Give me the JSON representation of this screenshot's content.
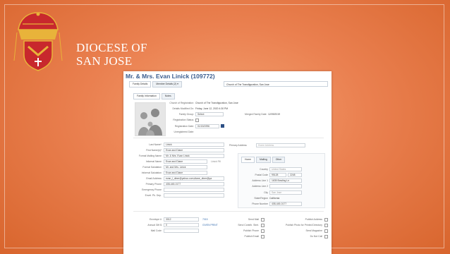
{
  "org": {
    "line1": "DIOCESE OF",
    "line2": "SAN JOSE"
  },
  "window": {
    "title": "Mr. & Mrs. Evan Linick (109772)"
  },
  "top_tabs": [
    "Family Details",
    "Member Details (2) ▾"
  ],
  "parish_select": "Church of The Transfiguration, San Jose",
  "sub_tabs": [
    "Family Information",
    "Notes"
  ],
  "registration": {
    "church_label": "Church of Registration:",
    "church_value": "Church of The Transfiguration, San Jose",
    "modified_label": "Details Modified On:",
    "modified_value": "Friday, June 12, 2020 4:30 PM",
    "group_label": "Family Group:",
    "group_value": "Select",
    "merged_label": "Merged Family Date:",
    "merged_value": "12/09/2019",
    "status_label": "Registration Status:",
    "regdate_label": "Registration Date:",
    "regdate_value": "01/15/1996",
    "unregistered_label": "Unregistered Date:"
  },
  "fields": [
    {
      "label": "Last Name*",
      "value": "Linick"
    },
    {
      "label": "First Name(s)*",
      "value": "Evan and Diane"
    },
    {
      "label": "Formal Mailing Name",
      "value": "Mr. & Mrs. Evan Linick"
    },
    {
      "label": "Informal Name",
      "value": "Evan and Diane"
    },
    {
      "label": "Formal Salutation",
      "value": "Mr. and Mrs. Linick"
    },
    {
      "label": "Informal Salutation",
      "value": "Evan and Diane"
    },
    {
      "label": "Email Address",
      "value": "evan_l_diner@yahoo.com;diane_diner@ya"
    },
    {
      "label": "Primary Phone",
      "value": "408-445-0177"
    },
    {
      "label": "Emergency Phone",
      "value": ""
    },
    {
      "label": "Envel. Pk. Dep.",
      "value": ""
    }
  ],
  "fields_side_note": "Linick Fill",
  "address": {
    "primary_label": "Primary Address",
    "primary_value": "Home Address",
    "tabs": [
      "Home",
      "Mailing",
      "Other"
    ],
    "rows": [
      {
        "label": "Country",
        "value": "United States"
      },
      {
        "label": "Postal Code",
        "value": "95128",
        "extra": "2248"
      },
      {
        "label": "Address Line 1",
        "value": "1635 Bowling Ln"
      },
      {
        "label": "Address Line 2",
        "value": ""
      },
      {
        "label": "City",
        "value": "San Jose"
      },
      {
        "label": "State/Region",
        "value": "California"
      },
      {
        "label": "Phone Number",
        "value": "408-445-0177"
      }
    ]
  },
  "bottom_left": [
    {
      "label": "Envelope #",
      "value": "3012",
      "side": "7015"
    },
    {
      "label": "Annual Gift $",
      "value": "0",
      "side": "GIVEN PRINT"
    },
    {
      "label": "Mail Code",
      "value": "",
      "side": ""
    }
  ],
  "bottom_mid": [
    "Send Mail",
    "Send Contrib. Stmt.",
    "Publish Phone",
    "Publish Email"
  ],
  "bottom_right": [
    "Publish Address",
    "Publish Photo for Printed Directory",
    "Send Magazine",
    "Do Not Call"
  ],
  "colors": {
    "background": "#ea8050",
    "title_blue": "#3a5d8f",
    "crest_red": "#c8282d",
    "crest_gold": "#e8b33a"
  }
}
